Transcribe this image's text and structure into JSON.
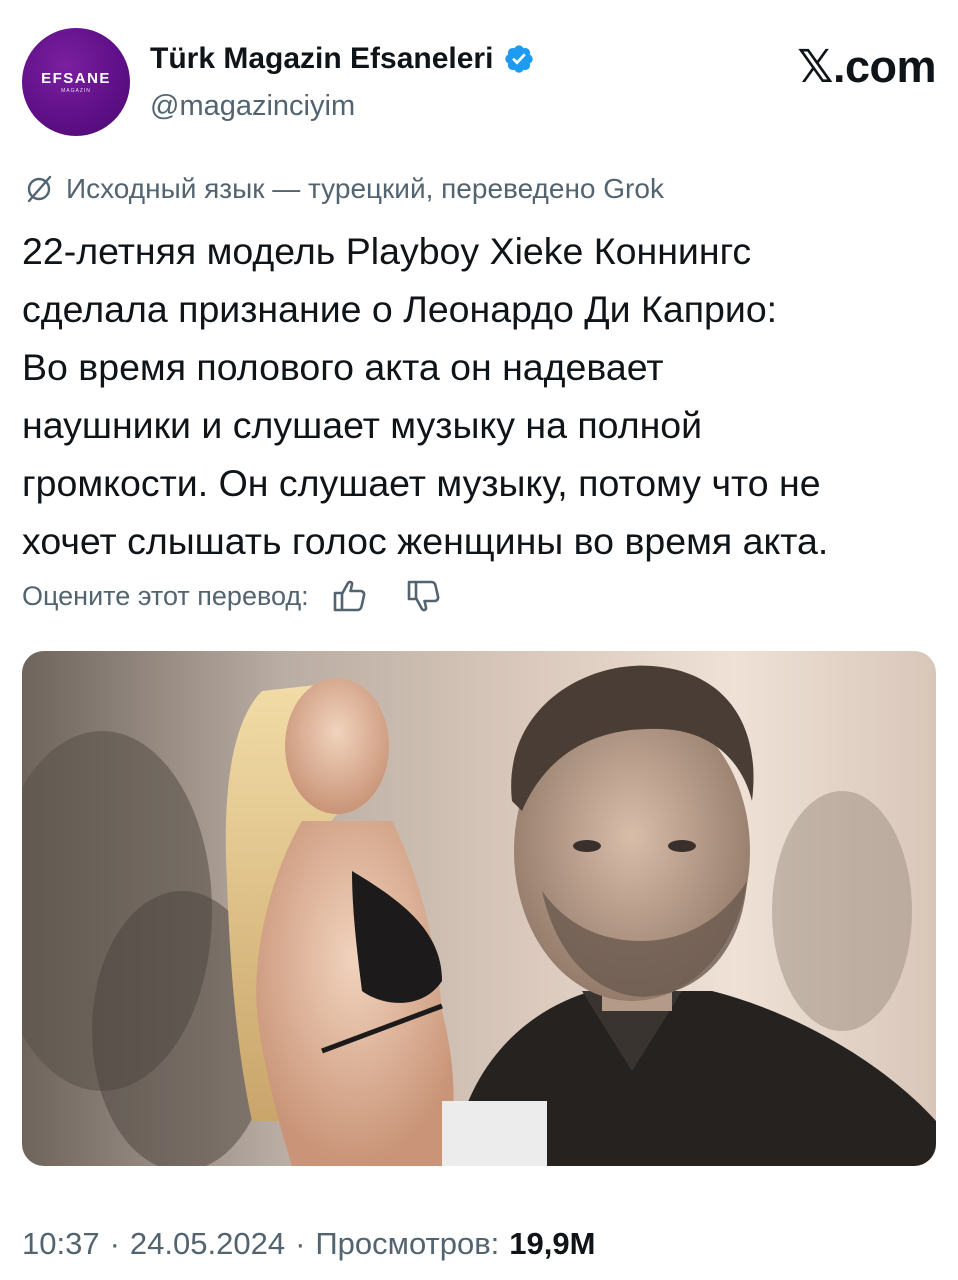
{
  "account": {
    "avatar_text": "EFSANE",
    "avatar_subtext": "MAGAZIN",
    "display_name": "Türk Magazin Efsaneleri",
    "handle": "@magazinciyim",
    "verified": true
  },
  "brand": "𝕏.com",
  "translation": {
    "note": "Исходный язык — турецкий, переведено Grok",
    "rate_label": "Оцените этот перевод:"
  },
  "tweet": {
    "text": "22-летняя модель Playboy Xieke Коннингс\nсделала признание о Леонардо Ди Каприо:\nВо время полового акта он надевает\nнаушники и слушает музыку на полной\nгромкости. Он слушает музыку, потому что не\nхочет слышать голос женщины во время акта."
  },
  "meta": {
    "time": "10:37",
    "separator": "·",
    "date": "24.05.2024",
    "views_label": "Просмотров:",
    "views_count": "19,9M"
  },
  "colors": {
    "text_primary": "#0f1419",
    "text_secondary": "#536471",
    "verified_blue": "#1d9bf0",
    "avatar_purple": "#5e0f86"
  },
  "icons": [
    "verified-badge-icon",
    "translate-icon",
    "thumbs-up-icon",
    "thumbs-down-icon"
  ]
}
